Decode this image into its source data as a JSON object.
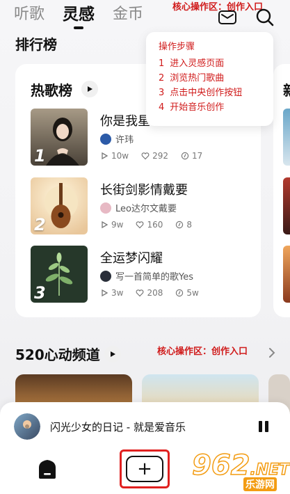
{
  "top_tabs": [
    {
      "label": "听歌",
      "active": false
    },
    {
      "label": "灵感",
      "active": true
    },
    {
      "label": "金币",
      "active": false
    }
  ],
  "top_annotation": "核心操作区：创作入口",
  "icons": {
    "mail": "mail-icon",
    "search": "search-icon"
  },
  "ranking": {
    "title": "排行榜"
  },
  "popup": {
    "title": "操作步骤",
    "steps": [
      {
        "num": "1",
        "text": "进入灵感页面"
      },
      {
        "num": "2",
        "text": "浏览热门歌曲"
      },
      {
        "num": "3",
        "text": "点击中央创作按钮"
      },
      {
        "num": "4",
        "text": "开始音乐创作"
      }
    ]
  },
  "hot_chart": {
    "title": "热歌榜",
    "songs": [
      {
        "rank": "1",
        "title": "你是我星",
        "artist": "许玮",
        "plays": "10w",
        "likes": "292",
        "covers": "17"
      },
      {
        "rank": "2",
        "title": "长街剑影情戴要",
        "artist": "Leo达尔文戴要",
        "plays": "9w",
        "likes": "160",
        "covers": "8"
      },
      {
        "rank": "3",
        "title": "全运梦闪耀",
        "artist": "写一首简单的歌Yes",
        "plays": "3w",
        "likes": "208",
        "covers": "5w"
      }
    ]
  },
  "next_card_peek": "新",
  "channel": {
    "title": "520心动频道",
    "annotation": "核心操作区：创作入口"
  },
  "player": {
    "now_playing": "闪光少女的日记 - 就是爱音乐"
  },
  "watermark": {
    "logo": "962",
    "suffix": ".NET",
    "sub": "乐游网"
  },
  "colors": {
    "annotation": "#d01b1b",
    "create_border": "#e0201f",
    "watermark": "#f39c12"
  }
}
